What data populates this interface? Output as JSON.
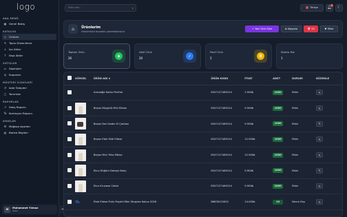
{
  "app": {
    "logo": "logo"
  },
  "sidebar": {
    "sections": [
      {
        "title": "ANA MENÜ",
        "items": [
          {
            "label": "Genel Bakış",
            "icon": "grid-icon",
            "active": false
          }
        ]
      },
      {
        "title": "KATALOG",
        "items": [
          {
            "label": "Ürünler",
            "icon": "tag-icon",
            "active": true
          },
          {
            "label": "Toplu Düzenleme",
            "icon": "edit-icon",
            "active": false
          },
          {
            "label": "İçe Aktar",
            "icon": "import-icon",
            "active": false
          },
          {
            "label": "Dışa Aktar",
            "icon": "export-icon",
            "active": false
          }
        ]
      },
      {
        "title": "SATIŞLAR",
        "items": [
          {
            "label": "Siparişler",
            "icon": "cart-icon",
            "active": false
          },
          {
            "label": "Kuponlar",
            "icon": "ticket-icon",
            "active": false
          }
        ]
      },
      {
        "title": "MÜŞTERİ İLİŞKİLERİ",
        "items": [
          {
            "label": "İade Talepleri",
            "icon": "return-icon",
            "active": false
          },
          {
            "label": "Yorumlar",
            "icon": "comment-icon",
            "active": false
          }
        ]
      },
      {
        "title": "RAPORLAR",
        "items": [
          {
            "label": "Satış Raporu",
            "icon": "chart-icon",
            "active": false
          },
          {
            "label": "Komisyon Raporu",
            "icon": "percent-icon",
            "active": false
          }
        ]
      },
      {
        "title": "AYARLAR",
        "items": [
          {
            "label": "Mağaza Ayarları",
            "icon": "gear-icon",
            "active": false
          },
          {
            "label": "Banka Bilgileri",
            "icon": "bank-icon",
            "active": false
          }
        ]
      }
    ],
    "user": {
      "initials": "M",
      "name": "Muhammet Yılmaz",
      "role": "Satıcı"
    }
  },
  "topbar": {
    "search_placeholder": "Ürün ara...",
    "language": "Türkçe",
    "notification_count": "1"
  },
  "header": {
    "title": "Ürünlerim",
    "subtitle": "Ürünlerinizi buradan yönetebilirsiniz",
    "actions": {
      "add": "Yeni Ürün Ekle",
      "copy": "Kopyala",
      "delete": "Sil",
      "filter": "Filtre"
    }
  },
  "stats": [
    {
      "label": "Toplam Ürün",
      "value": "26",
      "color": "#22c55e"
    },
    {
      "label": "Aktif Ürün",
      "value": "20",
      "color": "#2f7bf5"
    },
    {
      "label": "Pasif Ürün",
      "value": "2",
      "color": "#f2b705"
    },
    {
      "label": "Stokta Yok",
      "value": "1",
      "color": ""
    }
  ],
  "table": {
    "headers": {
      "image": "GÖRSEL",
      "name": "ÜRÜN ADI",
      "code": "ÜRÜN KODU",
      "price": "FİYAT",
      "qty": "ADET",
      "status": "DURUM",
      "edit": "DÜZENLE"
    },
    "rows": [
      {
        "image": "none",
        "name": "Armoağe Kadın Parfüm",
        "code": "8347127469124",
        "price": "2.900₺",
        "qty": "1000",
        "status": "Etkin"
      },
      {
        "image": "dress",
        "name": "Beyaz Büzgülü Mini Elbise",
        "code": "8347127469124",
        "price": "9.900₺",
        "qty": "1000",
        "status": "Etkin"
      },
      {
        "image": "bag",
        "name": "Beyaz Deri Kadın El Çantası",
        "code": "8347127469124",
        "price": "9.900₺",
        "qty": "1000",
        "status": "Etkin"
      },
      {
        "image": "dress",
        "name": "Beyaz Etek Midi Elbise",
        "code": "8347127469124",
        "price": "12.900₺",
        "qty": "1000",
        "status": "Etkin"
      },
      {
        "image": "dress",
        "name": "Beyaz Mini Triko Elbise",
        "code": "8347127469124",
        "price": "12.900₺",
        "qty": "1000",
        "status": "Etkin"
      },
      {
        "image": "dress",
        "name": "Ekru Düğüm Detaylı Body",
        "code": "8347127469124",
        "price": "9.900₺",
        "qty": "1000",
        "status": "Etkin"
      },
      {
        "image": "dress",
        "name": "Ekru Kruvaze Ceket",
        "code": "8347127469124",
        "price": "9.900₺",
        "qty": "1000",
        "status": "Etkin"
      },
      {
        "image": "shoe",
        "name": "Etek Elbise Pullu Payetli Mini Straplez Kokuz 2026",
        "code": "86638122621",
        "price": "14.000₺",
        "qty": "19",
        "status": "Devre Dışı"
      }
    ]
  }
}
